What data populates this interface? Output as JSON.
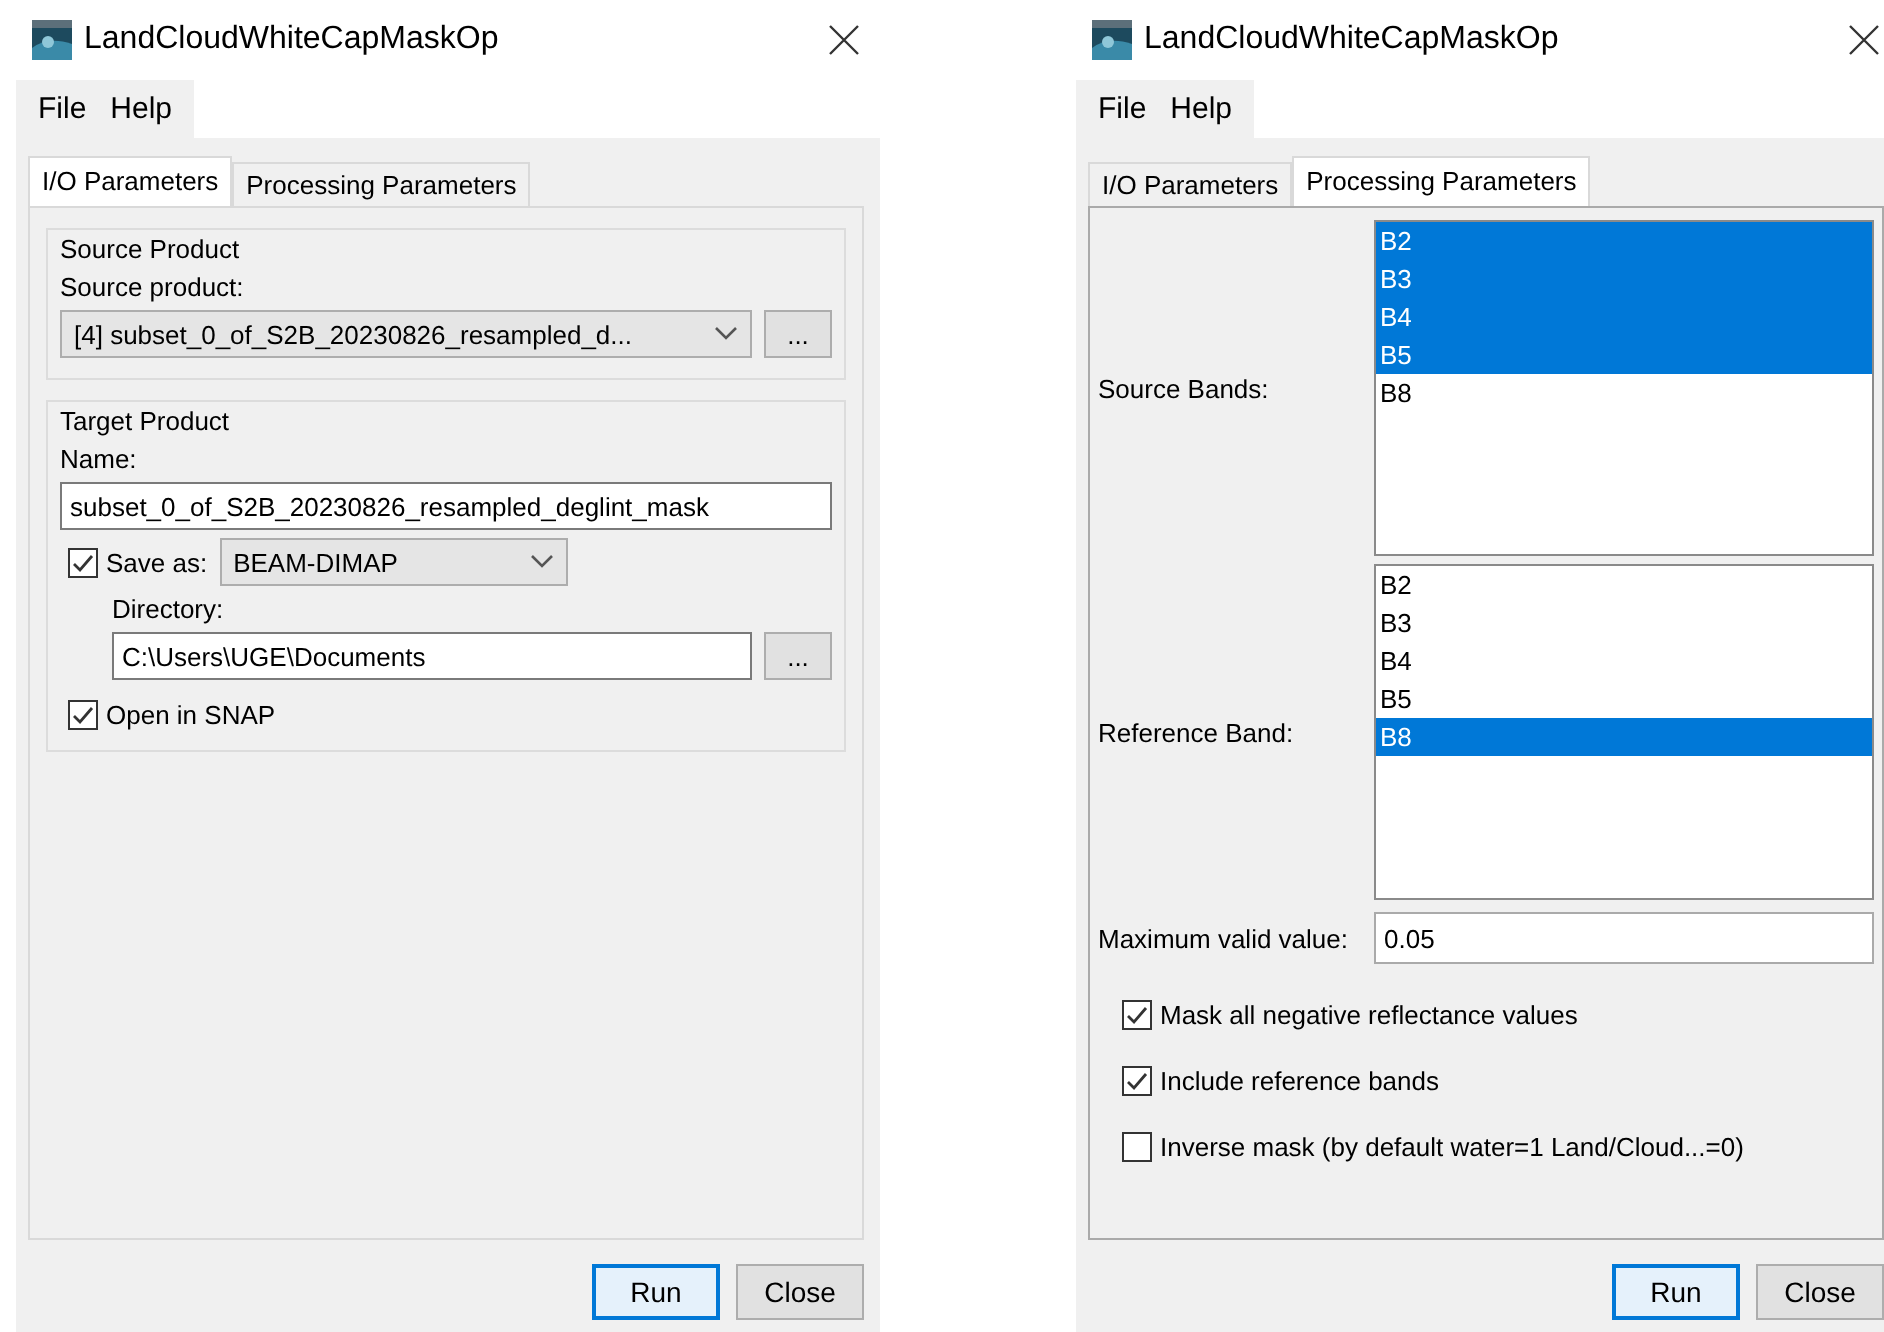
{
  "windows": [
    {
      "kind": "io",
      "title": "LandCloudWhiteCapMaskOp",
      "menu": [
        "File",
        "Help"
      ],
      "tabs": [
        {
          "label": "I/O Parameters",
          "selected": true
        },
        {
          "label": "Processing Parameters",
          "selected": false
        }
      ],
      "source_product": {
        "group_title": "Source Product",
        "label": "Source product:",
        "value": "[4] subset_0_of_S2B_20230826_resampled_d...",
        "browse": "..."
      },
      "target_product": {
        "group_title": "Target Product",
        "name_label": "Name:",
        "name_value": "subset_0_of_S2B_20230826_resampled_deglint_mask",
        "save_as": {
          "label": "Save as:",
          "checked": true,
          "format": "BEAM-DIMAP"
        },
        "directory_label": "Directory:",
        "directory_value": "C:\\Users\\UGE\\Documents",
        "browse": "...",
        "open_in_snap": {
          "label": "Open in SNAP",
          "checked": true
        }
      },
      "buttons": [
        {
          "label": "Run",
          "default": true
        },
        {
          "label": "Close",
          "default": false
        }
      ]
    },
    {
      "kind": "processing",
      "title": "LandCloudWhiteCapMaskOp",
      "menu": [
        "File",
        "Help"
      ],
      "tabs": [
        {
          "label": "I/O Parameters",
          "selected": false
        },
        {
          "label": "Processing Parameters",
          "selected": true
        }
      ],
      "source_bands": {
        "label": "Source Bands:",
        "items": [
          {
            "label": "B2",
            "selected": true
          },
          {
            "label": "B3",
            "selected": true
          },
          {
            "label": "B4",
            "selected": true
          },
          {
            "label": "B5",
            "selected": true
          },
          {
            "label": "B8",
            "selected": false
          }
        ]
      },
      "reference_band": {
        "label": "Reference Band:",
        "items": [
          {
            "label": "B2",
            "selected": false
          },
          {
            "label": "B3",
            "selected": false
          },
          {
            "label": "B4",
            "selected": false
          },
          {
            "label": "B5",
            "selected": false
          },
          {
            "label": "B8",
            "selected": true
          }
        ]
      },
      "max_valid": {
        "label": "Maximum valid value:",
        "value": "0.05"
      },
      "options": [
        {
          "label": "Mask all negative reflectance values",
          "checked": true
        },
        {
          "label": "Include reference bands",
          "checked": true
        },
        {
          "label": "Inverse mask (by default water=1 Land/Cloud...=0)",
          "checked": false
        }
      ],
      "buttons": [
        {
          "label": "Run",
          "default": true
        },
        {
          "label": "Close",
          "default": false
        }
      ]
    }
  ]
}
